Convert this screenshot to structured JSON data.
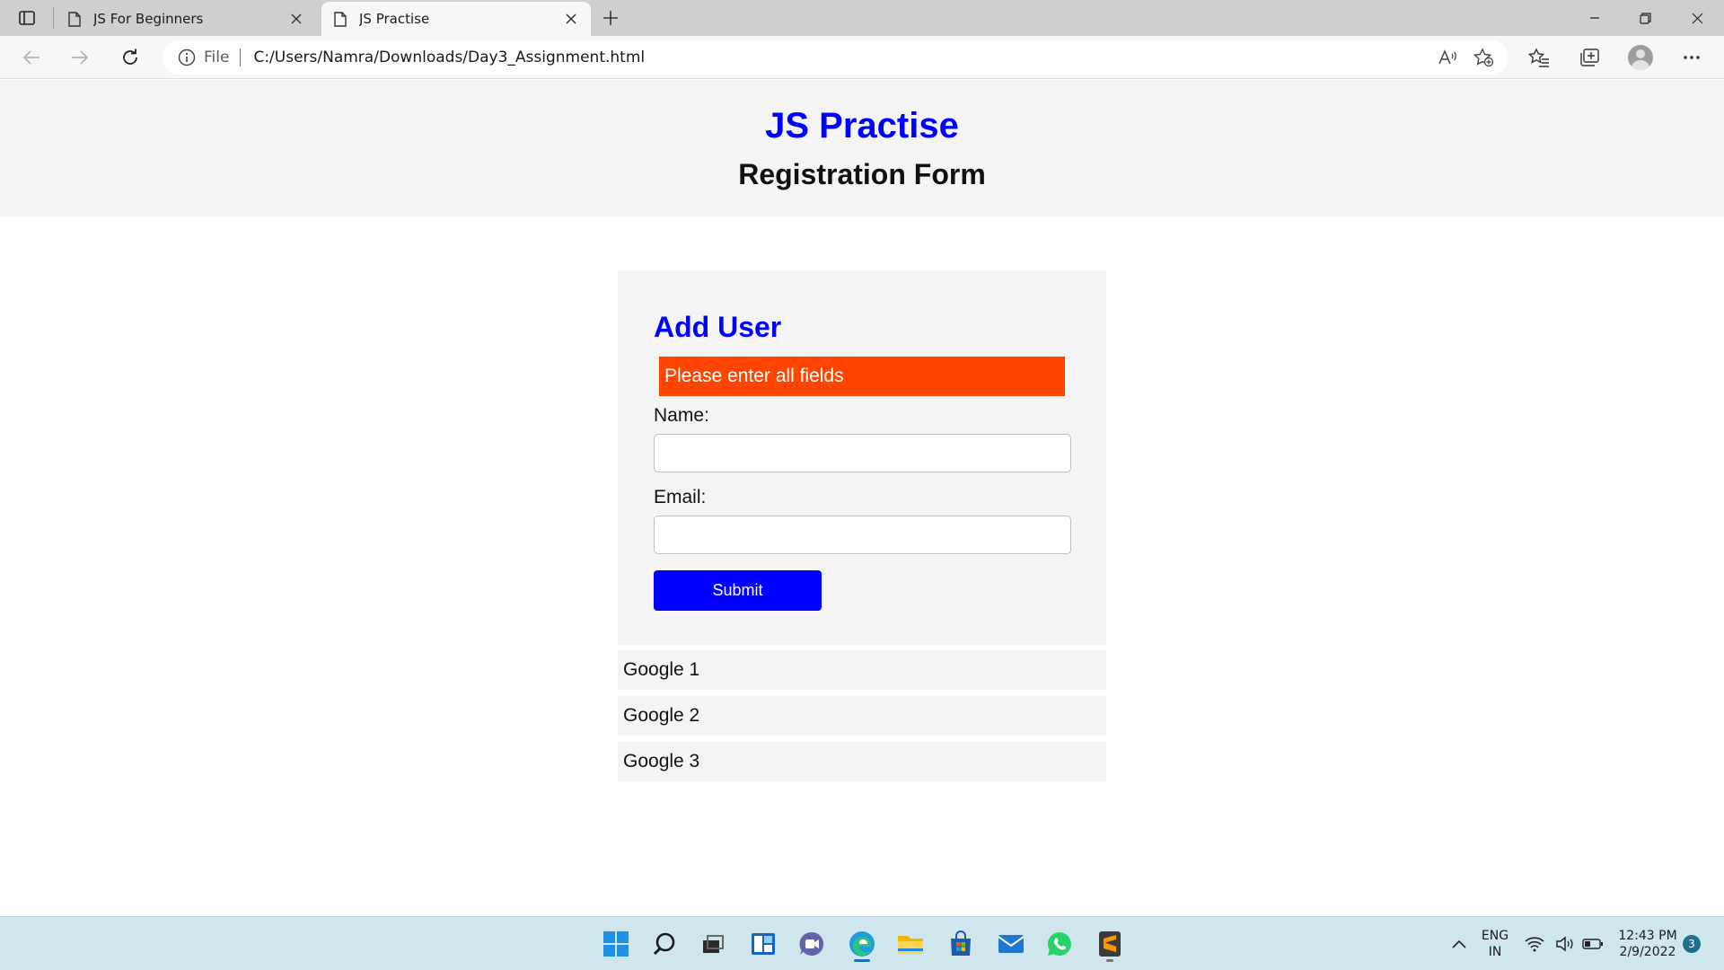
{
  "browser": {
    "tabs": [
      {
        "title": "JS For Beginners",
        "active": false
      },
      {
        "title": "JS Practise",
        "active": true
      }
    ],
    "address": {
      "scheme": "File",
      "url": "C:/Users/Namra/Downloads/Day3_Assignment.html"
    },
    "window_controls": {
      "minimize": "minimize-icon",
      "restore": "restore-icon",
      "close": "close-icon"
    }
  },
  "page": {
    "title": "JS Practise",
    "subtitle": "Registration Form",
    "form": {
      "heading": "Add User",
      "error": "Please enter all fields",
      "name_label": "Name:",
      "name_value": "",
      "email_label": "Email:",
      "email_value": "",
      "submit_label": "Submit"
    },
    "list": [
      "Google 1",
      "Google 2",
      "Google 3"
    ]
  },
  "taskbar": {
    "apps": [
      "start-icon",
      "search-icon",
      "task-view-icon",
      "widgets-icon",
      "teams-chat-icon",
      "edge-icon",
      "file-explorer-icon",
      "store-icon",
      "mail-icon",
      "whatsapp-icon",
      "sublime-text-icon"
    ],
    "tray": {
      "language": "ENG",
      "region": "IN",
      "time": "12:43 PM",
      "date": "2/9/2022",
      "notifications": "3"
    }
  },
  "colors": {
    "heading": "#0000ff",
    "error_bg": "#ff4500",
    "button_bg": "#0000ff",
    "card_bg": "#f4f4f4",
    "taskbar_bg": "#cfe6ec"
  }
}
